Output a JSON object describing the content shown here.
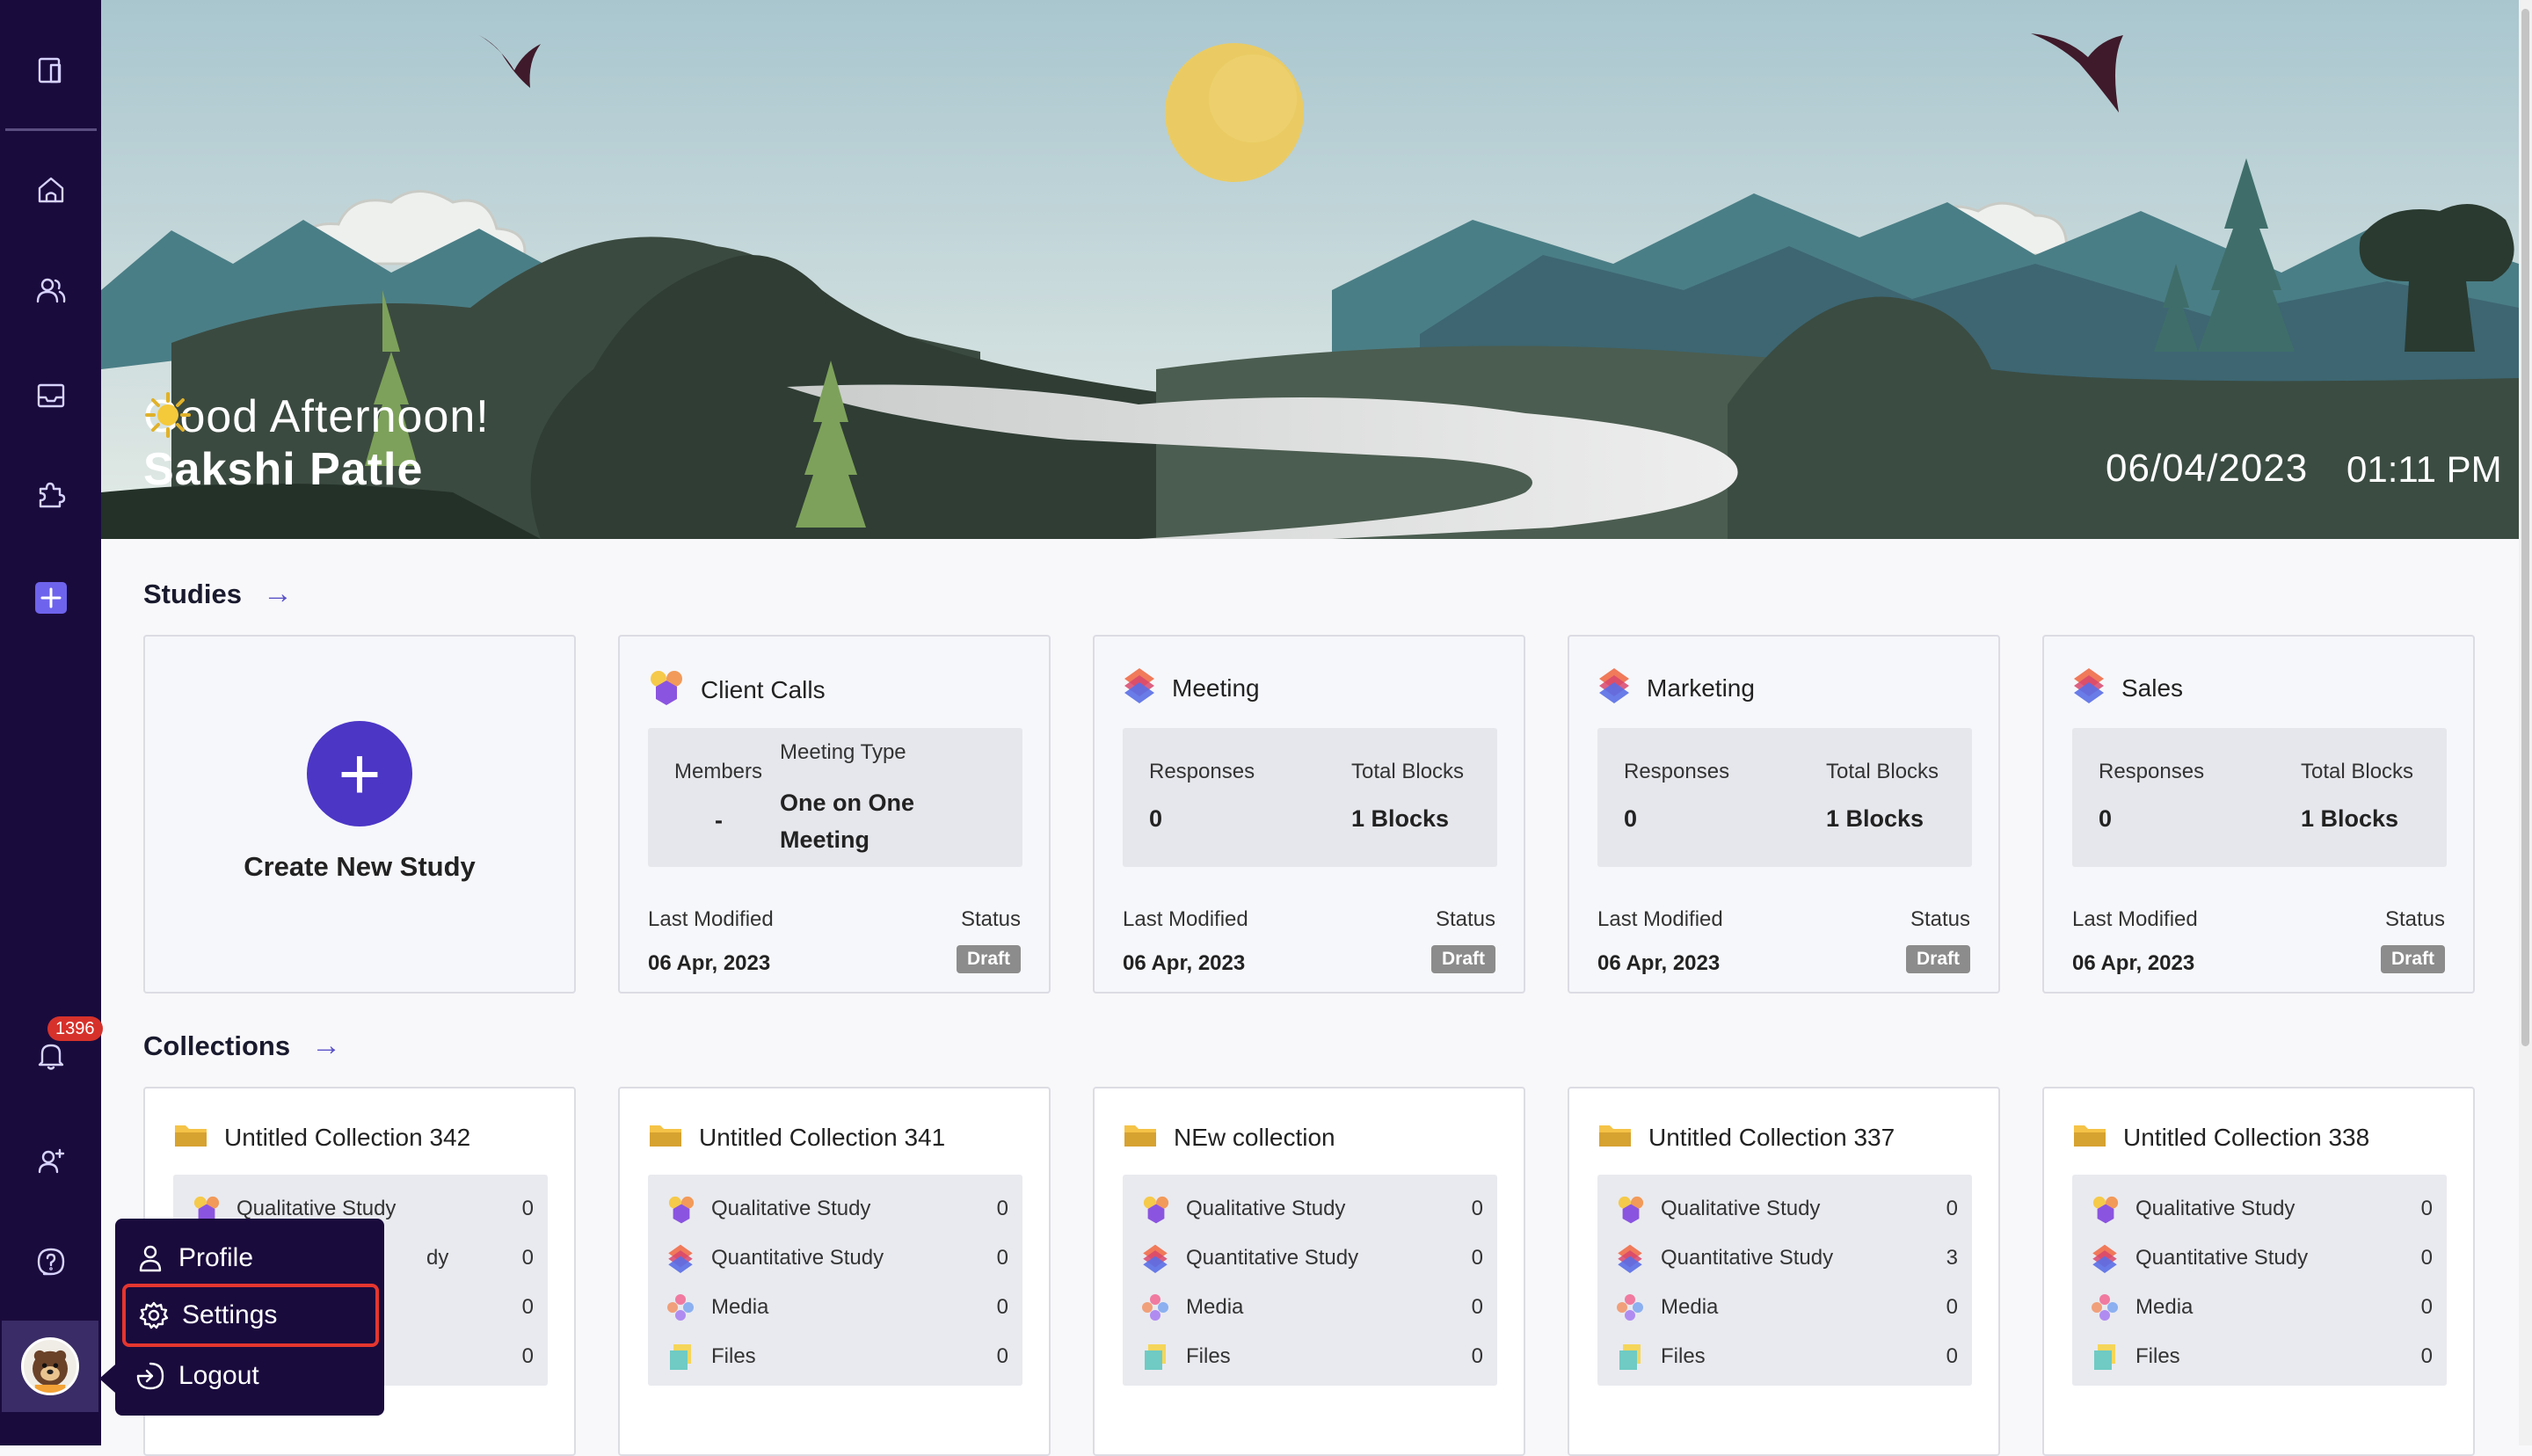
{
  "hero": {
    "greeting": "Good Afternoon!",
    "greeting_icon": "sun-icon",
    "user_name": "Sakshi Patle",
    "date": "06/04/2023",
    "time": "01:11 PM"
  },
  "sidebar": {
    "items": [
      {
        "icon": "sidebar-toggle-icon"
      },
      {
        "icon": "home-icon"
      },
      {
        "icon": "users-icon"
      },
      {
        "icon": "inbox-icon"
      },
      {
        "icon": "puzzle-icon"
      },
      {
        "icon": "add-icon"
      },
      {
        "icon": "bell-icon",
        "badge": "1396"
      },
      {
        "icon": "add-user-icon"
      },
      {
        "icon": "help-icon"
      },
      {
        "icon": "avatar"
      }
    ]
  },
  "studies": {
    "title": "Studies",
    "create_label": "Create New Study",
    "last_modified_label": "Last Modified",
    "status_label": "Status",
    "cards": [
      {
        "name": "Client Calls",
        "icon": "qualitative-study-icon",
        "members_label": "Members",
        "members_value": "-",
        "meeting_type_label": "Meeting Type",
        "meeting_type_value": "One on One Meeting",
        "last_modified": "06 Apr, 2023",
        "status": "Draft"
      },
      {
        "name": "Meeting",
        "icon": "quantitative-study-icon",
        "responses_label": "Responses",
        "responses_value": "0",
        "blocks_label": "Total Blocks",
        "blocks_value": "1 Blocks",
        "last_modified": "06 Apr, 2023",
        "status": "Draft"
      },
      {
        "name": "Marketing",
        "icon": "quantitative-study-icon",
        "responses_label": "Responses",
        "responses_value": "0",
        "blocks_label": "Total Blocks",
        "blocks_value": "1 Blocks",
        "last_modified": "06 Apr, 2023",
        "status": "Draft"
      },
      {
        "name": "Sales",
        "icon": "quantitative-study-icon",
        "responses_label": "Responses",
        "responses_value": "0",
        "blocks_label": "Total Blocks",
        "blocks_value": "1 Blocks",
        "last_modified": "06 Apr, 2023",
        "status": "Draft"
      }
    ]
  },
  "collections": {
    "title": "Collections",
    "cards": [
      {
        "name": "Untitled Collection 342",
        "rows": [
          {
            "label": "Qualitative Study",
            "count": "0"
          },
          {
            "label": "dy",
            "count": "0"
          },
          {
            "label": "",
            "count": "0"
          },
          {
            "label": "",
            "count": "0"
          }
        ]
      },
      {
        "name": "Untitled Collection 341",
        "rows": [
          {
            "label": "Qualitative Study",
            "count": "0"
          },
          {
            "label": "Quantitative Study",
            "count": "0"
          },
          {
            "label": "Media",
            "count": "0"
          },
          {
            "label": "Files",
            "count": "0"
          }
        ]
      },
      {
        "name": "NEw collection",
        "rows": [
          {
            "label": "Qualitative Study",
            "count": "0"
          },
          {
            "label": "Quantitative Study",
            "count": "0"
          },
          {
            "label": "Media",
            "count": "0"
          },
          {
            "label": "Files",
            "count": "0"
          }
        ]
      },
      {
        "name": "Untitled Collection 337",
        "rows": [
          {
            "label": "Qualitative Study",
            "count": "0"
          },
          {
            "label": "Quantitative Study",
            "count": "3"
          },
          {
            "label": "Media",
            "count": "0"
          },
          {
            "label": "Files",
            "count": "0"
          }
        ]
      },
      {
        "name": "Untitled Collection 338",
        "rows": [
          {
            "label": "Qualitative Study",
            "count": "0"
          },
          {
            "label": "Quantitative Study",
            "count": "0"
          },
          {
            "label": "Media",
            "count": "0"
          },
          {
            "label": "Files",
            "count": "0"
          }
        ]
      }
    ]
  },
  "user_menu": {
    "items": [
      {
        "label": "Profile",
        "icon": "profile-icon"
      },
      {
        "label": "Settings",
        "icon": "settings-icon"
      },
      {
        "label": "Logout",
        "icon": "logout-icon"
      }
    ]
  },
  "colors": {
    "sidebar_bg": "#1a0b3d",
    "accent": "#4b36c6",
    "badge": "#d6322b",
    "highlight": "#e5362f",
    "draft": "#8c8c8c"
  }
}
